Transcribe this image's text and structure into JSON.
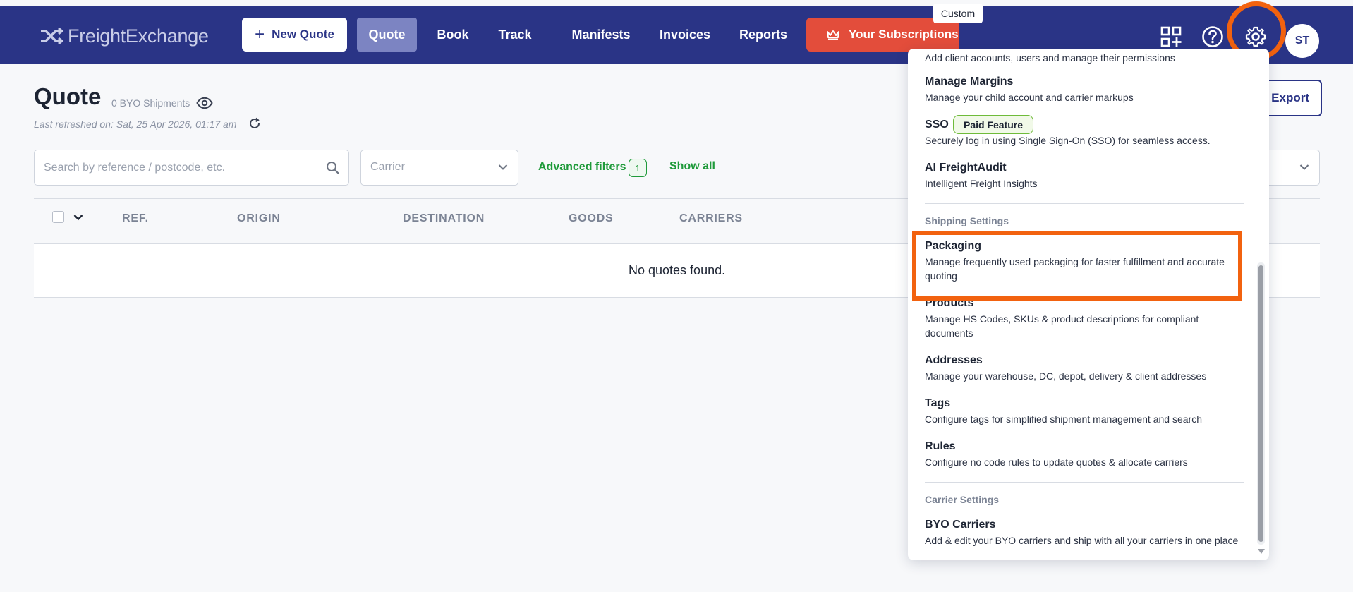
{
  "app": {
    "logo_text": "FreightExchange"
  },
  "nav": {
    "new_quote": "New Quote",
    "items": [
      "Quote",
      "Book",
      "Track",
      "Manifests",
      "Invoices",
      "Reports"
    ],
    "subscriptions": "Your Subscriptions",
    "custom_badge": "Custom",
    "avatar_initials": "ST"
  },
  "page": {
    "title": "Quote",
    "shipments": "0 BYO Shipments",
    "last_refreshed": "Last refreshed on: Sat, 25 Apr 2026, 01:17 am",
    "export": "Export"
  },
  "filters": {
    "search_placeholder": "Search by reference / postcode, etc.",
    "carrier_placeholder": "Carrier",
    "advanced_filters": "Advanced filters",
    "advanced_count": "1",
    "show_all": "Show all"
  },
  "table": {
    "columns": [
      "REF.",
      "ORIGIN",
      "DESTINATION",
      "GOODS",
      "CARRIERS"
    ],
    "empty_message": "No quotes found."
  },
  "settings_menu": {
    "top_partial_desc": "Add client accounts, users and manage their permissions",
    "account_items": [
      {
        "title": "Manage Margins",
        "desc": "Manage your child account and carrier markups"
      },
      {
        "title": "SSO",
        "badge": "Paid Feature",
        "desc": "Securely log in using Single Sign-On (SSO) for seamless access."
      },
      {
        "title": "AI FreightAudit",
        "desc": "Intelligent Freight Insights"
      }
    ],
    "shipping_section": "Shipping Settings",
    "shipping_items": [
      {
        "title": "Packaging",
        "desc_line1": "Manage frequently used packaging for faster fulfillment and accurate",
        "desc_line2": "quoting"
      },
      {
        "title": "Products",
        "desc_line1": "Manage HS Codes, SKUs & product descriptions for compliant",
        "desc_line2": "documents"
      },
      {
        "title": "Addresses",
        "desc": "Manage your warehouse, DC, depot, delivery & client addresses"
      },
      {
        "title": "Tags",
        "desc": "Configure tags for simplified shipment management and search"
      },
      {
        "title": "Rules",
        "desc": "Configure no code rules to update quotes & allocate carriers"
      }
    ],
    "carrier_section": "Carrier Settings",
    "carrier_items": [
      {
        "title": "BYO Carriers",
        "desc": "Add & edit your BYO carriers and ship with all your carriers in one place"
      }
    ]
  },
  "colors": {
    "topbar": "#2a3486",
    "accent_red": "#e34d3b",
    "highlight_orange": "#f2620f",
    "green": "#1f9a3a"
  },
  "icons": [
    "shuffle-logo-icon",
    "plus-icon",
    "crown-icon",
    "apps-add-icon",
    "help-icon",
    "gear-icon",
    "eye-icon",
    "refresh-icon",
    "search-icon",
    "chevron-down-icon"
  ]
}
